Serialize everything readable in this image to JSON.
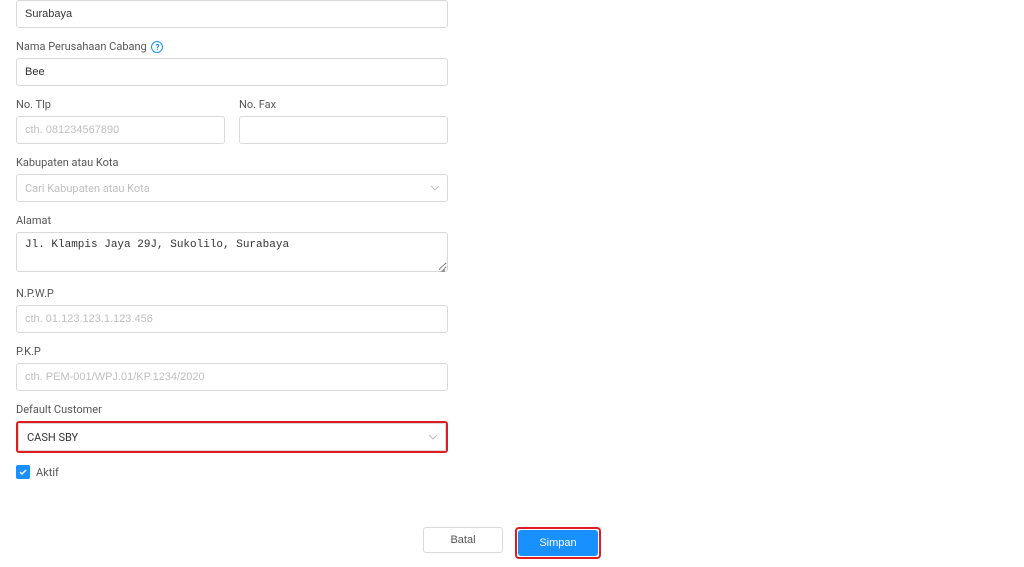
{
  "field_top": {
    "value": "Surabaya"
  },
  "nama_cabang": {
    "label": "Nama Perusahaan Cabang",
    "value": "Bee"
  },
  "no_tlp": {
    "label": "No. Tlp",
    "placeholder": "cth. 081234567890",
    "value": ""
  },
  "no_fax": {
    "label": "No. Fax",
    "placeholder": "",
    "value": ""
  },
  "kabupaten": {
    "label": "Kabupaten atau Kota",
    "placeholder": "Cari Kabupaten atau Kota",
    "value": ""
  },
  "alamat": {
    "label": "Alamat",
    "value": "Jl. Klampis Jaya 29J, Sukolilo, Surabaya"
  },
  "npwp": {
    "label": "N.P.W.P",
    "placeholder": "cth. 01.123.123.1.123.456",
    "value": ""
  },
  "pkp": {
    "label": "P.K.P",
    "placeholder": "cth. PEM-001/WPJ.01/KP.1234/2020",
    "value": ""
  },
  "default_customer": {
    "label": "Default Customer",
    "value": "CASH SBY"
  },
  "aktif": {
    "label": "Aktif",
    "checked": true
  },
  "footer": {
    "cancel": "Batal",
    "save": "Simpan"
  }
}
